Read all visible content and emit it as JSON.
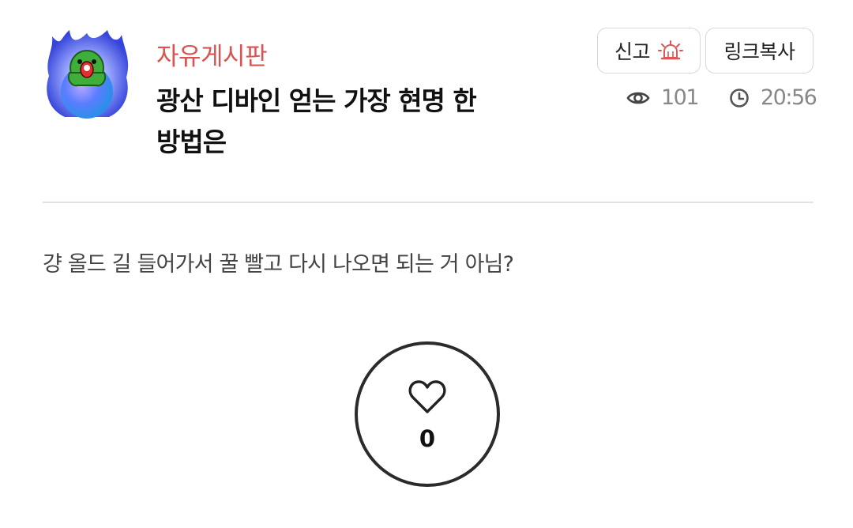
{
  "post": {
    "category": "자유게시판",
    "title": "광산 디바인 얻는 가장 현명 한 방법은",
    "body": "걍 올드 길 들어가서 꿀 빨고 다시 나오면 되는 거 아님?",
    "views": "101",
    "time": "20:56",
    "likes": "0"
  },
  "actions": {
    "report_label": "신고",
    "copy_link_label": "링크복사"
  },
  "icons": {
    "avatar": "blue-flame-egg-avatar",
    "report": "siren-icon",
    "views": "eye-icon",
    "time": "clock-icon",
    "like": "heart-icon"
  },
  "colors": {
    "category": "#d9534f",
    "siren": "#e05555",
    "meta": "#888888",
    "divider": "#e3e3e3"
  }
}
